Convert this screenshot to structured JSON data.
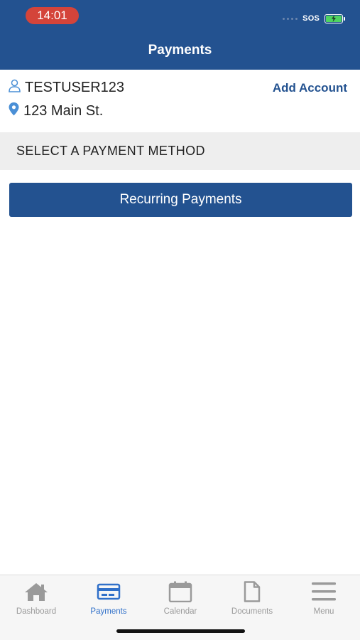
{
  "status_bar": {
    "time": "14:01",
    "carrier": "SOS"
  },
  "header": {
    "title": "Payments"
  },
  "account": {
    "username": "TESTUSER123",
    "address": "123 Main St.",
    "add_account_label": "Add Account"
  },
  "section": {
    "title": "SELECT A PAYMENT METHOD"
  },
  "actions": {
    "recurring_label": "Recurring Payments"
  },
  "tabbar": {
    "items": [
      {
        "label": "Dashboard",
        "icon": "home-icon",
        "active": false
      },
      {
        "label": "Payments",
        "icon": "credit-card-icon",
        "active": true
      },
      {
        "label": "Calendar",
        "icon": "calendar-icon",
        "active": false
      },
      {
        "label": "Documents",
        "icon": "document-icon",
        "active": false
      },
      {
        "label": "Menu",
        "icon": "hamburger-menu-icon",
        "active": false
      }
    ]
  },
  "colors": {
    "brand": "#235290",
    "active_tab": "#3070c9",
    "inactive_tab": "#9a9a9a",
    "time_pill": "#d4443a",
    "battery": "#4ed461"
  }
}
